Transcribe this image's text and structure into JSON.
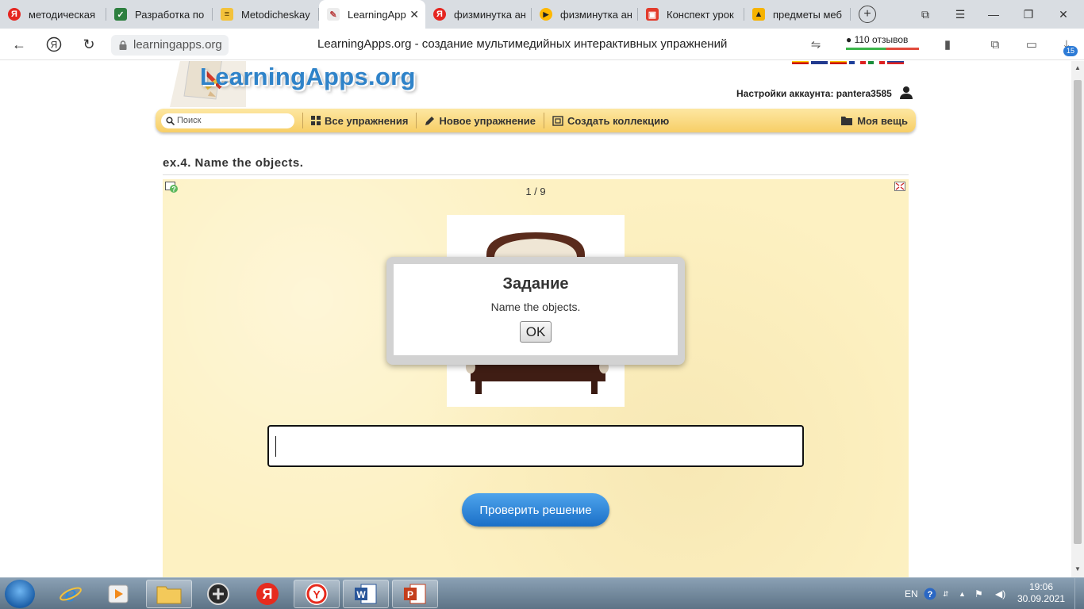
{
  "browser": {
    "tabs": [
      {
        "title": "методическая",
        "icon": "yandex-icon",
        "active": false
      },
      {
        "title": "Разработка по",
        "icon": "check-icon",
        "active": false
      },
      {
        "title": "Metodicheskay",
        "icon": "document-icon",
        "active": false
      },
      {
        "title": "LearningApp",
        "icon": "learningapps-icon",
        "active": true
      },
      {
        "title": "физминутка ан",
        "icon": "yandex-icon",
        "active": false
      },
      {
        "title": "физминутка ан",
        "icon": "play-icon",
        "active": false
      },
      {
        "title": "Конспект урок",
        "icon": "presentation-icon",
        "active": false
      },
      {
        "title": "предметы меб",
        "icon": "image-icon",
        "active": false
      }
    ],
    "url": "learningapps.org",
    "page_title": "LearningApps.org - создание мультимедийных интерактивных упражнений",
    "reviews": "110 отзывов",
    "downloads_badge": "15"
  },
  "site": {
    "logo": "LearningApps.org",
    "account_label": "Настройки аккаунта: pantera3585",
    "search_placeholder": "Поиск",
    "nav": {
      "all_exercises": "Все упражнения",
      "new_exercise": "Новое упражнение",
      "create_collection": "Создать коллекцию",
      "my_stuff": "Моя вещь"
    }
  },
  "exercise": {
    "title": "ex.4. Name the objects.",
    "counter": "1 / 9",
    "answer_value": "",
    "check_button": "Проверить решение"
  },
  "modal": {
    "title": "Задание",
    "text": "Name the objects.",
    "ok": "OK"
  },
  "taskbar": {
    "language": "EN",
    "time": "19:06",
    "date": "30.09.2021"
  }
}
